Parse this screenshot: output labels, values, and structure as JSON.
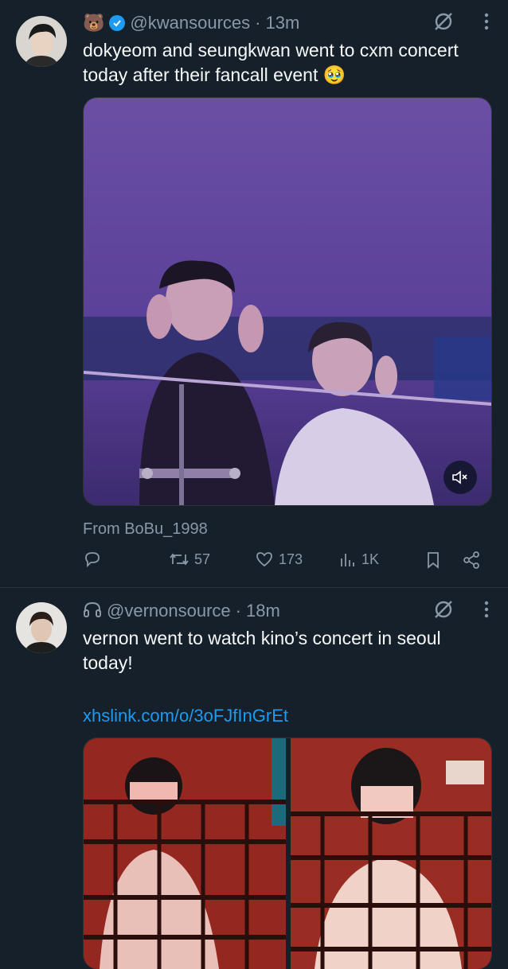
{
  "tweet1": {
    "name_emoji": "🐻",
    "handle": "@kwansources",
    "separator": "·",
    "time": "13m",
    "text": "dokyeom and seungkwan went to cxm concert today after their fancall event 🥹",
    "source": "From BoBu_1998",
    "counts": {
      "reply": "",
      "retweet": "57",
      "like": "173",
      "views": "1K"
    },
    "icons": [
      "verified-badge-icon",
      "grok-icon",
      "more-icon",
      "reply-icon",
      "retweet-icon",
      "like-icon",
      "views-icon",
      "bookmark-icon",
      "share-icon",
      "mute-icon"
    ]
  },
  "tweet2": {
    "name_emoji": "🎧",
    "handle": "@vernonsource",
    "separator": "·",
    "time": "18m",
    "text": "vernon went to watch kino’s concert in seoul today!",
    "link": "xhslink.com/o/3oFJfInGrEt"
  },
  "colors": {
    "background": "#15202b",
    "text": "#f7f9f9",
    "secondary": "#8b98a5",
    "accent": "#1d9bf0",
    "divider": "#2f3336"
  }
}
